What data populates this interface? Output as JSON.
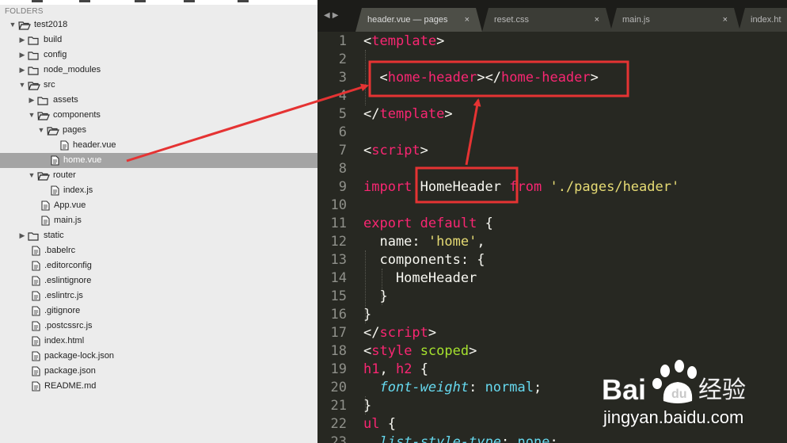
{
  "sidebar": {
    "header": "FOLDERS",
    "tree": [
      {
        "label": "test2018",
        "depth": 0,
        "kind": "folder",
        "state": "open",
        "name": "tree-folder-test2018"
      },
      {
        "label": "build",
        "depth": 1,
        "kind": "folder",
        "state": "closed",
        "name": "tree-folder-build"
      },
      {
        "label": "config",
        "depth": 1,
        "kind": "folder",
        "state": "closed",
        "name": "tree-folder-config"
      },
      {
        "label": "node_modules",
        "depth": 1,
        "kind": "folder",
        "state": "closed",
        "name": "tree-folder-node-modules"
      },
      {
        "label": "src",
        "depth": 1,
        "kind": "folder",
        "state": "open",
        "name": "tree-folder-src"
      },
      {
        "label": "assets",
        "depth": 2,
        "kind": "folder",
        "state": "closed",
        "name": "tree-folder-assets"
      },
      {
        "label": "components",
        "depth": 2,
        "kind": "folder",
        "state": "open",
        "name": "tree-folder-components"
      },
      {
        "label": "pages",
        "depth": 3,
        "kind": "folder",
        "state": "open",
        "name": "tree-folder-pages"
      },
      {
        "label": "header.vue",
        "depth": 4,
        "kind": "file",
        "name": "tree-file-header-vue"
      },
      {
        "label": "home.vue",
        "depth": 3,
        "kind": "file",
        "selected": true,
        "name": "tree-file-home-vue"
      },
      {
        "label": "router",
        "depth": 2,
        "kind": "folder",
        "state": "open",
        "name": "tree-folder-router"
      },
      {
        "label": "index.js",
        "depth": 3,
        "kind": "file",
        "name": "tree-file-router-index-js"
      },
      {
        "label": "App.vue",
        "depth": 2,
        "kind": "file",
        "name": "tree-file-app-vue"
      },
      {
        "label": "main.js",
        "depth": 2,
        "kind": "file",
        "name": "tree-file-main-js"
      },
      {
        "label": "static",
        "depth": 1,
        "kind": "folder",
        "state": "closed",
        "name": "tree-folder-static"
      },
      {
        "label": ".babelrc",
        "depth": 1,
        "kind": "file",
        "name": "tree-file-babelrc"
      },
      {
        "label": ".editorconfig",
        "depth": 1,
        "kind": "file",
        "name": "tree-file-editorconfig"
      },
      {
        "label": ".eslintignore",
        "depth": 1,
        "kind": "file",
        "name": "tree-file-eslintignore"
      },
      {
        "label": ".eslintrc.js",
        "depth": 1,
        "kind": "file",
        "name": "tree-file-eslintrc-js"
      },
      {
        "label": ".gitignore",
        "depth": 1,
        "kind": "file",
        "name": "tree-file-gitignore"
      },
      {
        "label": ".postcssrc.js",
        "depth": 1,
        "kind": "file",
        "name": "tree-file-postcssrc-js"
      },
      {
        "label": "index.html",
        "depth": 1,
        "kind": "file",
        "name": "tree-file-index-html"
      },
      {
        "label": "package-lock.json",
        "depth": 1,
        "kind": "file",
        "name": "tree-file-package-lock-json"
      },
      {
        "label": "package.json",
        "depth": 1,
        "kind": "file",
        "name": "tree-file-package-json"
      },
      {
        "label": "README.md",
        "depth": 1,
        "kind": "file",
        "name": "tree-file-readme-md"
      }
    ]
  },
  "editor": {
    "nav": {
      "back": "◀",
      "forward": "▶"
    },
    "tabs": [
      {
        "label": "header.vue — pages",
        "close": "×",
        "active": true,
        "name": "tab-header-vue"
      },
      {
        "label": "reset.css",
        "close": "×",
        "active": false,
        "name": "tab-reset-css"
      },
      {
        "label": "main.js",
        "close": "×",
        "active": false,
        "name": "tab-main-js"
      },
      {
        "label": "index.ht",
        "close": "",
        "active": false,
        "name": "tab-index-html"
      }
    ],
    "lines": [
      {
        "n": "1",
        "tokens": [
          [
            "<",
            "w"
          ],
          [
            "template",
            "p"
          ],
          [
            ">",
            "w"
          ]
        ]
      },
      {
        "n": "2",
        "tokens": []
      },
      {
        "n": "3",
        "tokens": [
          [
            "  ",
            "w"
          ],
          [
            "<",
            "w"
          ],
          [
            "home-header",
            "p"
          ],
          [
            "></",
            "w"
          ],
          [
            "home-header",
            "p"
          ],
          [
            ">",
            "w"
          ]
        ]
      },
      {
        "n": "4",
        "tokens": []
      },
      {
        "n": "5",
        "tokens": [
          [
            "</",
            "w"
          ],
          [
            "template",
            "p"
          ],
          [
            ">",
            "w"
          ]
        ]
      },
      {
        "n": "6",
        "tokens": []
      },
      {
        "n": "7",
        "tokens": [
          [
            "<",
            "w"
          ],
          [
            "script",
            "p"
          ],
          [
            ">",
            "w"
          ]
        ]
      },
      {
        "n": "8",
        "tokens": []
      },
      {
        "n": "9",
        "tokens": [
          [
            "import",
            "p"
          ],
          [
            " HomeHeader ",
            "w"
          ],
          [
            "from",
            "p"
          ],
          [
            " ",
            "w"
          ],
          [
            "'./pages/header'",
            "y"
          ]
        ]
      },
      {
        "n": "10",
        "tokens": []
      },
      {
        "n": "11",
        "tokens": [
          [
            "export",
            "p"
          ],
          [
            " ",
            "w"
          ],
          [
            "default",
            "p"
          ],
          [
            " {",
            "w"
          ]
        ]
      },
      {
        "n": "12",
        "tokens": [
          [
            "  name: ",
            "w"
          ],
          [
            "'home'",
            "y"
          ],
          [
            ",",
            "w"
          ]
        ]
      },
      {
        "n": "13",
        "tokens": [
          [
            "  components: {",
            "w"
          ]
        ]
      },
      {
        "n": "14",
        "tokens": [
          [
            "    HomeHeader",
            "w"
          ]
        ]
      },
      {
        "n": "15",
        "tokens": [
          [
            "  }",
            "w"
          ]
        ]
      },
      {
        "n": "16",
        "tokens": [
          [
            "}",
            "w"
          ]
        ]
      },
      {
        "n": "17",
        "tokens": [
          [
            "</",
            "w"
          ],
          [
            "script",
            "p"
          ],
          [
            ">",
            "w"
          ]
        ]
      },
      {
        "n": "18",
        "tokens": [
          [
            "<",
            "w"
          ],
          [
            "style",
            "p"
          ],
          [
            " ",
            "w"
          ],
          [
            "scoped",
            "g"
          ],
          [
            ">",
            "w"
          ]
        ]
      },
      {
        "n": "19",
        "tokens": [
          [
            "h1",
            "p"
          ],
          [
            ", ",
            "w"
          ],
          [
            "h2",
            "p"
          ],
          [
            " {",
            "w"
          ]
        ]
      },
      {
        "n": "20",
        "tokens": [
          [
            "  ",
            "w"
          ],
          [
            "font-weight",
            "c"
          ],
          [
            ": ",
            "w"
          ],
          [
            "normal",
            "b"
          ],
          [
            ";",
            "w"
          ]
        ]
      },
      {
        "n": "21",
        "tokens": [
          [
            "}",
            "w"
          ]
        ]
      },
      {
        "n": "22",
        "tokens": [
          [
            "ul",
            "p"
          ],
          [
            " {",
            "w"
          ]
        ]
      },
      {
        "n": "23",
        "tokens": [
          [
            "  ",
            "w"
          ],
          [
            "list-style-type",
            "c"
          ],
          [
            ": ",
            "w"
          ],
          [
            "none",
            "b"
          ],
          [
            ";",
            "w"
          ]
        ]
      }
    ]
  },
  "colors": {
    "annotation_red": "#e53333",
    "sidebar_bg": "#ececec",
    "editor_bg": "#272822",
    "keyword_pink": "#f92672",
    "string_yellow": "#e6db74"
  },
  "watermark": {
    "logo_text": "Bai 经验",
    "url": "jingyan.baidu.com"
  }
}
